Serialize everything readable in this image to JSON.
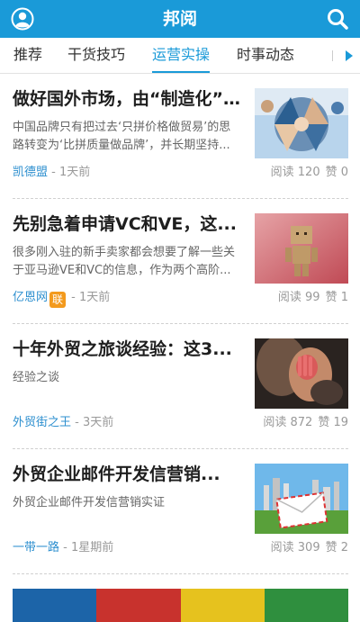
{
  "app": {
    "title": "邦阅"
  },
  "icons": {
    "left": "user-icon",
    "right": "search-icon"
  },
  "colors": {
    "accent": "#1a9ad8",
    "source": "#2d8fcf",
    "badge": "#f39a1d"
  },
  "tabs": [
    {
      "label": "推荐",
      "active": false
    },
    {
      "label": "干货技巧",
      "active": false
    },
    {
      "label": "运营实操",
      "active": true
    },
    {
      "label": "时事动态",
      "active": false
    }
  ],
  "articles": [
    {
      "headline": "做好国外市场，由“制造化”...",
      "summary": "中国品牌只有把过去‘只拼价格做贸易’的思路转变为‘比拼质量做品牌’，并长期坚持...",
      "source": "凯德盟",
      "time": "- 1天前",
      "reads": "阅读 120",
      "likes": "赞 0",
      "thumb": "team-hands-photo"
    },
    {
      "headline": "先别急着申请VC和VE，这...",
      "summary": "很多刚入驻的新手卖家都会想要了解一些关于亚马逊VE和VC的信息，作为两个高阶...",
      "source": "亿恩网",
      "badge": "联",
      "time": "- 1天前",
      "reads": "阅读 99",
      "likes": "赞 1",
      "thumb": "cardboard-robot-photo"
    },
    {
      "headline": "十年外贸之旅谈经验：这3...",
      "summary": "经验之谈",
      "source": "外贸街之王",
      "time": "- 3天前",
      "reads": "阅读 872",
      "likes": "赞 19",
      "thumb": "woman-hands-photo"
    },
    {
      "headline": "外贸企业邮件开发信营销...",
      "summary": "外贸企业邮件开发信营销实证",
      "source": "一带一路",
      "time": "- 1星期前",
      "reads": "阅读 309",
      "likes": "赞 2",
      "thumb": "envelope-city-photo"
    }
  ]
}
